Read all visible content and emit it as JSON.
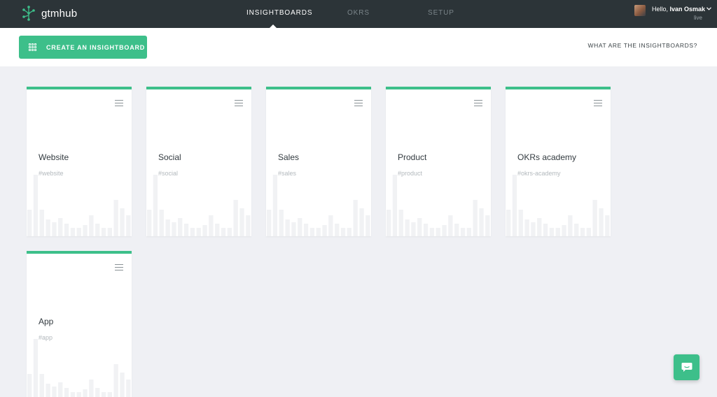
{
  "app": {
    "name": "gtmhub"
  },
  "nav": {
    "tabs": [
      {
        "label": "INSIGHTBOARDS",
        "active": true
      },
      {
        "label": "OKRS",
        "active": false
      },
      {
        "label": "SETUP",
        "active": false
      }
    ]
  },
  "user": {
    "greeting": "Hello,",
    "name": "Ivan Osmak",
    "status": "live"
  },
  "actions": {
    "create_label": "CREATE AN INSIGHTBOARD",
    "help_link": "WHAT ARE THE INSIGHTBOARDS?"
  },
  "boards": [
    {
      "title": "Website",
      "tag": "#website"
    },
    {
      "title": "Social",
      "tag": "#social"
    },
    {
      "title": "Sales",
      "tag": "#sales"
    },
    {
      "title": "Product",
      "tag": "#product"
    },
    {
      "title": "OKRs academy",
      "tag": "#okrs-academy"
    },
    {
      "title": "App",
      "tag": "#app"
    }
  ],
  "colors": {
    "accent": "#3dbf8a",
    "topbar": "#2c3438",
    "background": "#eff0f4"
  },
  "icons": {
    "logo": "network-icon",
    "create": "grid-icon",
    "menu": "hamburger-icon",
    "chat": "chat-icon",
    "user_menu": "chevron-down-icon"
  }
}
